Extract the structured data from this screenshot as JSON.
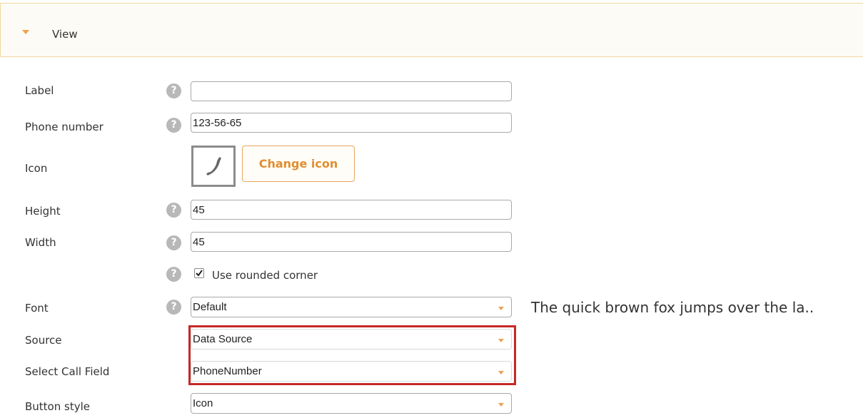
{
  "section": {
    "title": "View"
  },
  "fields": {
    "label": {
      "label": "Label",
      "value": ""
    },
    "phone": {
      "label": "Phone number",
      "value": "123-56-65"
    },
    "icon": {
      "label": "Icon",
      "button": "Change icon"
    },
    "height": {
      "label": "Height",
      "value": "45"
    },
    "width": {
      "label": "Width",
      "value": "45"
    },
    "rounded": {
      "label": "Use rounded corner",
      "checked": true
    },
    "font": {
      "label": "Font",
      "value": "Default",
      "preview": "The quick brown fox jumps over the la.."
    },
    "source": {
      "label": "Source",
      "value": "Data Source"
    },
    "call_field": {
      "label": "Select Call Field",
      "value": "PhoneNumber"
    },
    "button_style": {
      "label": "Button style",
      "value": "Icon"
    }
  },
  "help_glyph": "?",
  "colors": {
    "accent": "#f0a04b",
    "highlight": "#c62828",
    "help": "#b8b8b8"
  },
  "icons": [
    "chevron-down-icon",
    "help-icon",
    "phone-icon",
    "checkmark-icon"
  ]
}
